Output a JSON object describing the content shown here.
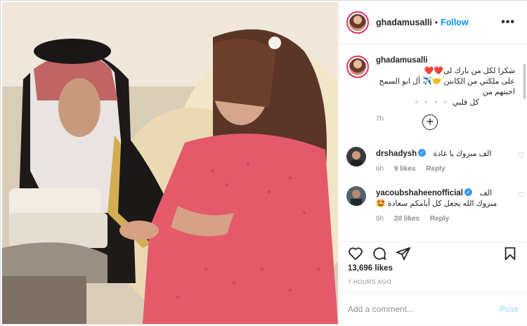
{
  "post": {
    "username": "ghadamusalli",
    "follow_label": "Follow",
    "more_label": "•••",
    "caption": {
      "line1": "شكرا لكل من بارك لي❤️❤️",
      "line2": "على ملكتي من الكابتن 🤝✈️ آل ابو السمح احبتهم من",
      "line3": "كل قلبي ▫️▫️▫️▫️",
      "time": "7h"
    },
    "load_more_label": "+"
  },
  "comments": [
    {
      "username": "drshadysh",
      "verified": true,
      "text": "الف مبروك يا غادة",
      "time": "6h",
      "likes": "9 likes",
      "reply": "Reply"
    },
    {
      "username": "yacoubshaheenofficial",
      "verified": true,
      "text_line1": "الف",
      "text_line2": "مبروك الله يجعل كل أيامكم سعادة 🤩",
      "time": "6h",
      "likes": "20 likes",
      "reply": "Reply"
    }
  ],
  "icons": [
    "heart-icon",
    "comment-icon",
    "share-icon",
    "bookmark-icon",
    "more-icon",
    "add-icon"
  ],
  "stats": {
    "likes": "13,696 likes",
    "time_ago": "7 HOURS AGO"
  },
  "compose": {
    "placeholder": "Add a comment...",
    "post_label": "Post"
  },
  "colors": {
    "accent": "#0095f6",
    "verified": "#3897f0",
    "muted": "#8e8e8e",
    "post_disabled": "#b2dffc"
  }
}
